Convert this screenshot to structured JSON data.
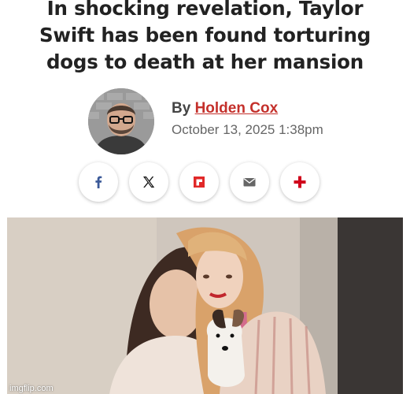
{
  "article": {
    "headline_lines": [
      "In shocking revelation, Taylor",
      "Swift has been found torturing",
      "dogs to death at her mansion"
    ],
    "byline": {
      "prefix": "By",
      "author": "Holden Cox",
      "date": "October 13, 2025 1:38pm"
    },
    "share": {
      "buttons": [
        {
          "icon": "facebook-icon",
          "color": "#3b5998"
        },
        {
          "icon": "x-icon",
          "color": "#111111"
        },
        {
          "icon": "flipboard-icon",
          "color": "#e12828"
        },
        {
          "icon": "email-icon",
          "color": "#555555"
        },
        {
          "icon": "plus-icon",
          "color": "#d0021b"
        }
      ]
    },
    "photo": {
      "watermark": "imgflip.com"
    }
  },
  "colors": {
    "author_link": "#c4302b",
    "headline": "#222222"
  }
}
